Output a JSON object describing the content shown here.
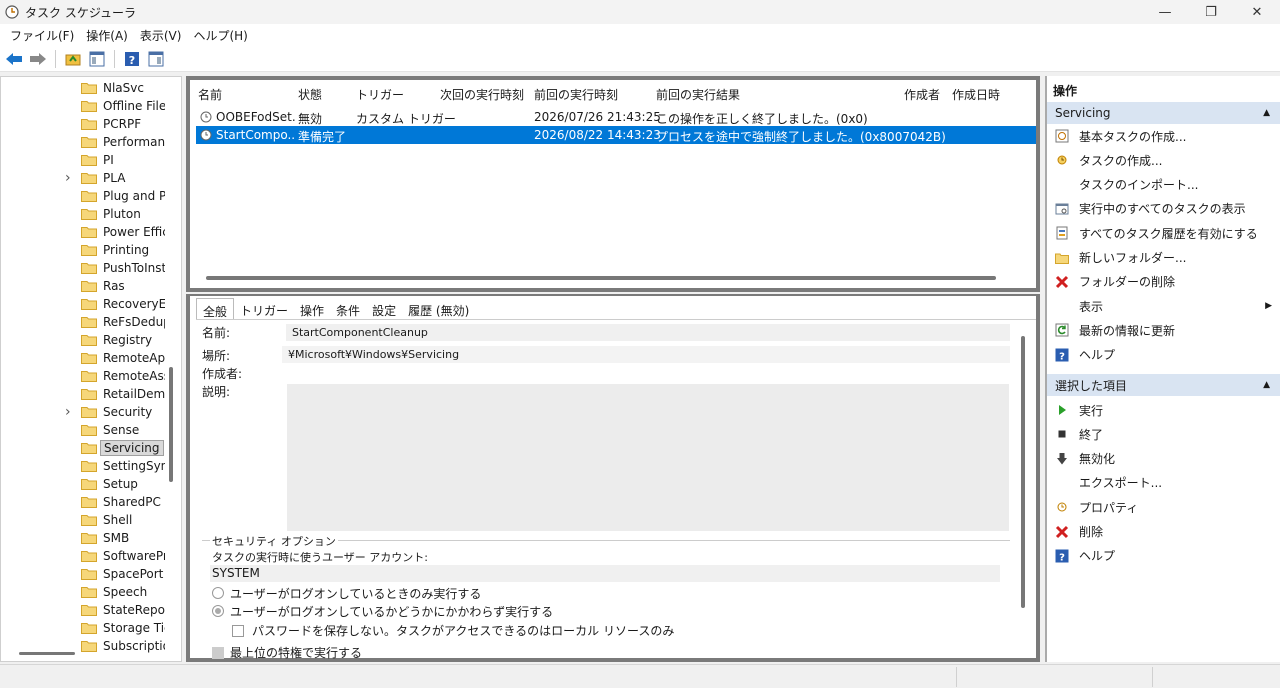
{
  "window": {
    "title": "タスク スケジューラ"
  },
  "menu": [
    "ファイル(F)",
    "操作(A)",
    "表示(V)",
    "ヘルプ(H)"
  ],
  "toolbar": [
    "back-arrow-icon",
    "forward-arrow-icon",
    "folder-up-icon",
    "show-hide-tree-icon",
    "help-icon",
    "show-hide-action-icon"
  ],
  "tree": {
    "items": [
      {
        "label": "NlaSvc",
        "expand": false
      },
      {
        "label": "Offline Files",
        "expand": false
      },
      {
        "label": "PCRPF",
        "expand": false
      },
      {
        "label": "Performanc",
        "expand": false
      },
      {
        "label": "PI",
        "expand": false
      },
      {
        "label": "PLA",
        "expand": true
      },
      {
        "label": "Plug and Pla",
        "expand": false
      },
      {
        "label": "Pluton",
        "expand": false
      },
      {
        "label": "Power Efficie",
        "expand": false
      },
      {
        "label": "Printing",
        "expand": false
      },
      {
        "label": "PushToInsta",
        "expand": false
      },
      {
        "label": "Ras",
        "expand": false
      },
      {
        "label": "RecoveryEn",
        "expand": false
      },
      {
        "label": "ReFsDedup",
        "expand": false
      },
      {
        "label": "Registry",
        "expand": false
      },
      {
        "label": "RemoteApp",
        "expand": false
      },
      {
        "label": "RemoteAssi",
        "expand": false
      },
      {
        "label": "RetailDemo",
        "expand": false
      },
      {
        "label": "Security",
        "expand": true
      },
      {
        "label": "Sense",
        "expand": false
      },
      {
        "label": "Servicing",
        "expand": false,
        "selected": true
      },
      {
        "label": "SettingSync",
        "expand": false
      },
      {
        "label": "Setup",
        "expand": false
      },
      {
        "label": "SharedPC",
        "expand": false
      },
      {
        "label": "Shell",
        "expand": false
      },
      {
        "label": "SMB",
        "expand": false
      },
      {
        "label": "SoftwarePro",
        "expand": false
      },
      {
        "label": "SpacePort",
        "expand": false
      },
      {
        "label": "Speech",
        "expand": false
      },
      {
        "label": "StateReposi",
        "expand": false
      },
      {
        "label": "Storage Tier",
        "expand": false
      },
      {
        "label": "Subscription",
        "expand": false
      }
    ]
  },
  "tasklist": {
    "columns": [
      "名前",
      "状態",
      "トリガー",
      "次回の実行時刻",
      "前回の実行時刻",
      "前回の実行結果",
      "作成者",
      "作成日時"
    ],
    "rows": [
      {
        "name": "OOBEFodSet...",
        "status": "無効",
        "trigger": "カスタム トリガー",
        "next": "",
        "last": "2026/07/26 21:43:25",
        "result": "この操作を正しく終了しました。(0x0)",
        "author": "",
        "created": "",
        "selected": false
      },
      {
        "name": "StartCompo...",
        "status": "準備完了",
        "trigger": "",
        "next": "",
        "last": "2026/08/22 14:43:23",
        "result": "プロセスを途中で強制終了しました。(0x8007042B)",
        "author": "",
        "created": "",
        "selected": true
      }
    ]
  },
  "detail": {
    "tabs": [
      "全般",
      "トリガー",
      "操作",
      "条件",
      "設定",
      "履歴 (無効)"
    ],
    "name_label": "名前:",
    "name_value": "StartComponentCleanup",
    "location_label": "場所:",
    "location_value": "¥Microsoft¥Windows¥Servicing",
    "author_label": "作成者:",
    "desc_label": "説明:",
    "security": {
      "title": "セキュリティ オプション",
      "account_label": "タスクの実行時に使うユーザー アカウント:",
      "account_value": "SYSTEM",
      "opt_logged_on": "ユーザーがログオンしているときのみ実行する",
      "opt_whether": "ユーザーがログオンしているかどうかにかかわらず実行する",
      "opt_no_password": "パスワードを保存しない。タスクがアクセスできるのはローカル リソースのみ",
      "opt_highest": "最上位の特権で実行する"
    }
  },
  "actions": {
    "header": "操作",
    "section1": "Servicing",
    "items1": [
      {
        "label": "基本タスクの作成...",
        "icon": "basic-task-icon"
      },
      {
        "label": "タスクの作成...",
        "icon": "create-task-icon"
      },
      {
        "label": "タスクのインポート...",
        "icon": ""
      },
      {
        "label": "実行中のすべてのタスクの表示",
        "icon": "running-tasks-icon"
      },
      {
        "label": "すべてのタスク履歴を有効にする",
        "icon": "history-icon"
      },
      {
        "label": "新しいフォルダー...",
        "icon": "new-folder-icon"
      },
      {
        "label": "フォルダーの削除",
        "icon": "delete-x-icon"
      },
      {
        "label": "表示",
        "icon": "",
        "submenu": true
      },
      {
        "label": "最新の情報に更新",
        "icon": "refresh-icon"
      },
      {
        "label": "ヘルプ",
        "icon": "help-icon"
      }
    ],
    "section2": "選択した項目",
    "items2": [
      {
        "label": "実行",
        "icon": "run-icon"
      },
      {
        "label": "終了",
        "icon": "stop-icon"
      },
      {
        "label": "無効化",
        "icon": "disable-icon"
      },
      {
        "label": "エクスポート...",
        "icon": ""
      },
      {
        "label": "プロパティ",
        "icon": "properties-icon"
      },
      {
        "label": "削除",
        "icon": "delete-x-icon"
      },
      {
        "label": "ヘルプ",
        "icon": "help-icon"
      }
    ]
  }
}
